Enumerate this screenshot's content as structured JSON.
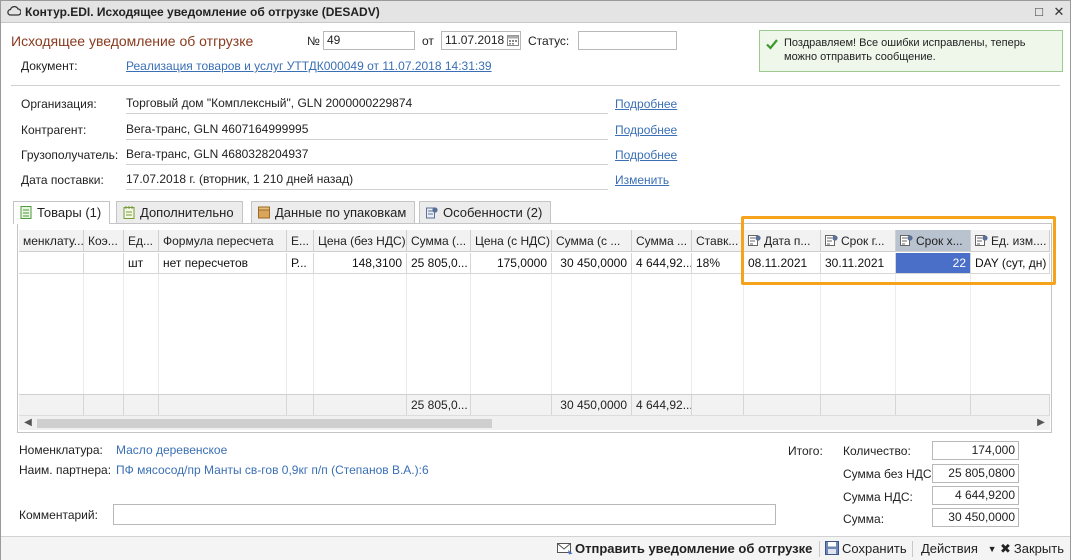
{
  "window": {
    "title": "Контур.EDI. Исходящее уведомление об отгрузке (DESADV)"
  },
  "header": {
    "heading": "Исходящее уведомление об отгрузке",
    "number_label": "№",
    "number_value": "49",
    "date_label": "от",
    "date_value": "11.07.2018",
    "status_label": "Статус:",
    "status_value": "",
    "document_label": "Документ:",
    "document_link": "Реализация товаров и услуг УТТДК000049 от 11.07.2018 14:31:39"
  },
  "notice": {
    "text": "Поздравляем! Все ошибки исправлены, теперь можно отправить сообщение."
  },
  "details": {
    "org_label": "Организация:",
    "org_value": "Торговый дом \"Комплексный\", GLN 2000000229874",
    "org_link": "Подробнее",
    "counterparty_label": "Контрагент:",
    "counterparty_value": "Вега-транс, GLN 4607164999995",
    "counterparty_link": "Подробнее",
    "consignee_label": "Грузополучатель:",
    "consignee_value": "Вега-транс, GLN 4680328204937",
    "consignee_link": "Подробнее",
    "delivery_label": "Дата поставки:",
    "delivery_value": "17.07.2018 г. (вторник, 1 210 дней назад)",
    "delivery_link": "Изменить"
  },
  "tabs": [
    {
      "label": "Товары (1)"
    },
    {
      "label": "Дополнительно"
    },
    {
      "label": "Данные по упаковкам"
    },
    {
      "label": "Особенности (2)"
    }
  ],
  "grid": {
    "headers": [
      "менклату...",
      "Коэ...",
      "Ед...",
      "Формула пересчета",
      "Е...",
      "Цена (без НДС)",
      "Сумма (...",
      "Цена (с НДС)",
      "Сумма (с ...",
      "Сумма ...",
      "Ставк...",
      "Дата п...",
      "Срок г...",
      "Срок х...",
      "Ед. изм...."
    ],
    "row": [
      "",
      "",
      "шт",
      "нет пересчетов",
      "Р...",
      "148,3100",
      "25 805,0...",
      "175,0000",
      "30 450,0000",
      "4 644,92...",
      "18%",
      "08.11.2021",
      "30.11.2021",
      "22",
      "DAY (сут, дн)"
    ],
    "footer": [
      "",
      "",
      "",
      "",
      "",
      "",
      "25 805,0...",
      "",
      "30 450,0000",
      "4 644,92...",
      "",
      "",
      "",
      "",
      ""
    ]
  },
  "bottom_info": {
    "nomenclature_label": "Номенклатура:",
    "nomenclature_value": "Масло деревенское",
    "partner_label": "Наим. партнера:",
    "partner_value": "ПФ мясосод/пр Манты св-гов 0,9кг п/п (Степанов В.А.):6",
    "comment_label": "Комментарий:",
    "comment_value": ""
  },
  "totals": {
    "total_label": "Итого:",
    "quantity_label": "Количество:",
    "quantity_value": "174,000",
    "sum_no_vat_label": "Сумма без НДС:",
    "sum_no_vat_value": "25 805,0800",
    "vat_label": "Сумма НДС:",
    "vat_value": "4 644,9200",
    "sum_label": "Сумма:",
    "sum_value": "30 450,0000"
  },
  "toolbar": {
    "send_label": "Отправить уведомление об отгрузке",
    "save_label": "Сохранить",
    "actions_label": "Действия",
    "close_label": "Закрыть"
  },
  "colors": {
    "highlight": "#f5a31a",
    "link": "#3a6fb5",
    "selected_cell": "#4a6fc9",
    "notice_bg": "#eef7ea"
  }
}
